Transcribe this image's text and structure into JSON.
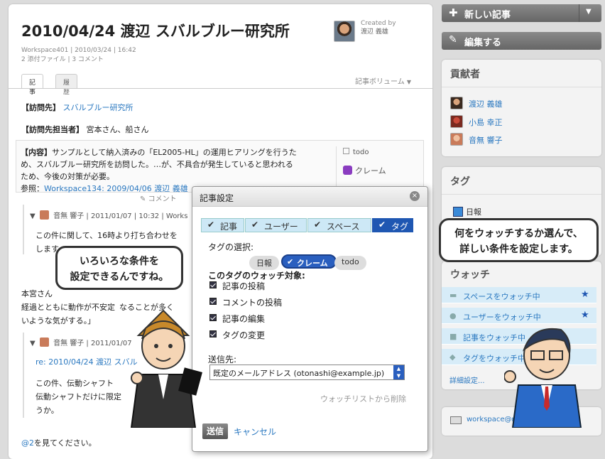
{
  "sidebar": {
    "new_article": "新しい記事",
    "edit": "編集する",
    "contributors_title": "貢献者",
    "contributors": [
      "渡辺 義雄",
      "小島 幸正",
      "音無 響子"
    ],
    "tags_title": "タグ",
    "tag_item": "日報",
    "watch_title": "ウォッチ",
    "watch_items": [
      "スペースをウォッチ中",
      "ユーザーをウォッチ中",
      "記事をウォッチ中",
      "タグをウォッチ中"
    ],
    "watch_detail": "詳細設定...",
    "email": "workspace@ruhun"
  },
  "article": {
    "title": "2010/04/24 渡辺 スバルブルー研究所",
    "created_by_label": "Created by",
    "created_by_name": "渡辺 義雄",
    "meta_line1": "Workspace401 | 2010/03/24 | 16:42",
    "meta_line2": "2 添付ファイル | 3 コメント",
    "tab_article": "記事",
    "tab_history": "履歴",
    "volume": "記事ボリューム",
    "visit_label": "【訪問先】",
    "visit_value": "スバルブルー研究所",
    "person_label": "【訪問先担当者】",
    "person_value": "宮本さん、船さん",
    "content_label": "【内容】",
    "content_line1": "サンプルとして納入済みの「EL2005-HL」の運用ヒアリングを行うた",
    "content_line2": "め、スバルブルー研究所を訪問した。…が、不具合が発生していると思われる",
    "content_line3": "ため、今後の対策が必要。",
    "ref_label": "参照：",
    "ref_link": "Workspace134: 2009/04/06 渡辺 義雄",
    "tag_todo": "todo",
    "tag_claim": "クレーム",
    "comment_button": "コメント",
    "comment1_author": "音無 響子 | 2011/01/07 | 10:32 | Works",
    "comment1_line1": "この件に関して、16時より打ち合わせを",
    "comment1_line2": "します。",
    "body_line1": "本宮さん",
    "body_line2": "経過とともに動作が不安定",
    "body_line2b": "なることが多く",
    "body_line3": "いような気がする。」",
    "comment2_author": "音無 響子 | 2011/01/07",
    "comment2_ref": "re: 2010/04/24 渡辺 スバル",
    "comment2_line1": "この件、伝動シャフト",
    "comment2_line2": "伝動シャフトだけに限定",
    "comment2_line3": "うか。",
    "footer_mention": "@2",
    "footer_text": "を見てください。"
  },
  "dialog": {
    "title": "記事設定",
    "tabs": [
      "記事",
      "ユーザー",
      "スペース",
      "タグ"
    ],
    "tag_select_label": "タグの選択:",
    "tags": [
      "日報",
      "クレーム",
      "todo"
    ],
    "watch_target_label": "このタグのウォッチ対象:",
    "options": [
      "記事の投稿",
      "コメントの投稿",
      "記事の編集",
      "タグの変更"
    ],
    "send_to_label": "送信先:",
    "send_to_value": "既定のメールアドレス (otonashi@example.jp)",
    "remove_link": "ウォッチリストから削除",
    "send_button": "送信",
    "cancel": "キャンセル"
  },
  "bubbles": {
    "left": "いろいろな条件を\n設定できるんですね。",
    "right": "何をウォッチするか選んで、\n詳しい条件を設定します。"
  }
}
